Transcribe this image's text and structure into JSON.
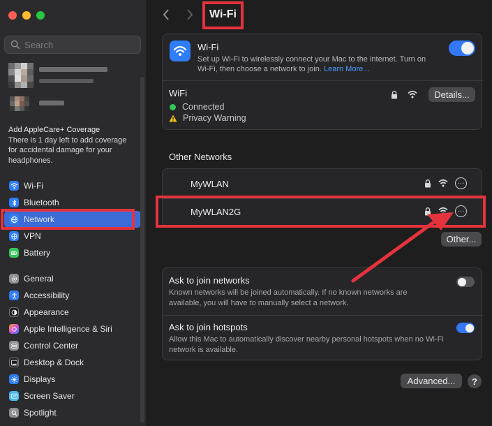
{
  "window": {
    "title": "Wi-Fi"
  },
  "sidebar": {
    "search": {
      "placeholder": "Search"
    },
    "applecare": {
      "title": "Add AppleCare+ Coverage",
      "body": "There is 1 day left to add coverage for accidental damage for your headphones."
    },
    "group1": [
      {
        "label": "Wi-Fi",
        "icon": "wifi-icon",
        "color": "#2f7df7"
      },
      {
        "label": "Bluetooth",
        "icon": "bluetooth-icon",
        "color": "#2f7df7"
      },
      {
        "label": "Network",
        "icon": "globe-icon",
        "color": "#2f7df7",
        "active": true
      },
      {
        "label": "VPN",
        "icon": "vpn-icon",
        "color": "#2f7df7"
      },
      {
        "label": "Battery",
        "icon": "battery-icon",
        "color": "#34c759"
      }
    ],
    "group2": [
      {
        "label": "General",
        "icon": "gear-icon",
        "color": "#8e8e93"
      },
      {
        "label": "Accessibility",
        "icon": "accessibility-icon",
        "color": "#2f7df7"
      },
      {
        "label": "Appearance",
        "icon": "appearance-icon",
        "color": "#1c1c1e"
      },
      {
        "label": "Apple Intelligence & Siri",
        "icon": "siri-icon",
        "color": "#d94fd8"
      },
      {
        "label": "Control Center",
        "icon": "control-center-icon",
        "color": "#8e8e93"
      },
      {
        "label": "Desktop & Dock",
        "icon": "dock-icon",
        "color": "#1c1c1e"
      },
      {
        "label": "Displays",
        "icon": "displays-icon",
        "color": "#2f7df7"
      },
      {
        "label": "Screen Saver",
        "icon": "screen-saver-icon",
        "color": "#46b6e8"
      },
      {
        "label": "Spotlight",
        "icon": "spotlight-icon",
        "color": "#8e8e93"
      }
    ]
  },
  "wifi_panel": {
    "title": "Wi-Fi",
    "description": "Set up Wi-Fi to wirelessly connect your Mac to the internet. Turn on Wi-Fi, then choose a network to join.",
    "learn_more": "Learn More...",
    "enabled": true,
    "current_network": {
      "name": "WiFi",
      "status": "Connected",
      "warning": "Privacy Warning",
      "details_label": "Details..."
    }
  },
  "other_networks": {
    "heading": "Other Networks",
    "networks": [
      {
        "name": "MyWLAN"
      },
      {
        "name": "MyWLAN2G"
      }
    ],
    "other_label": "Other..."
  },
  "options": {
    "ask_networks": {
      "title": "Ask to join networks",
      "description": "Known networks will be joined automatically. If no known networks are available, you will have to manually select a network.",
      "enabled": false
    },
    "ask_hotspots": {
      "title": "Ask to join hotspots",
      "description": "Allow this Mac to automatically discover nearby personal hotspots when no Wi-Fi network is available.",
      "enabled": true
    }
  },
  "footer": {
    "advanced_label": "Advanced...",
    "help_label": "?"
  },
  "colors": {
    "accent": "#3478f6",
    "annotation_red": "#e4333d"
  }
}
